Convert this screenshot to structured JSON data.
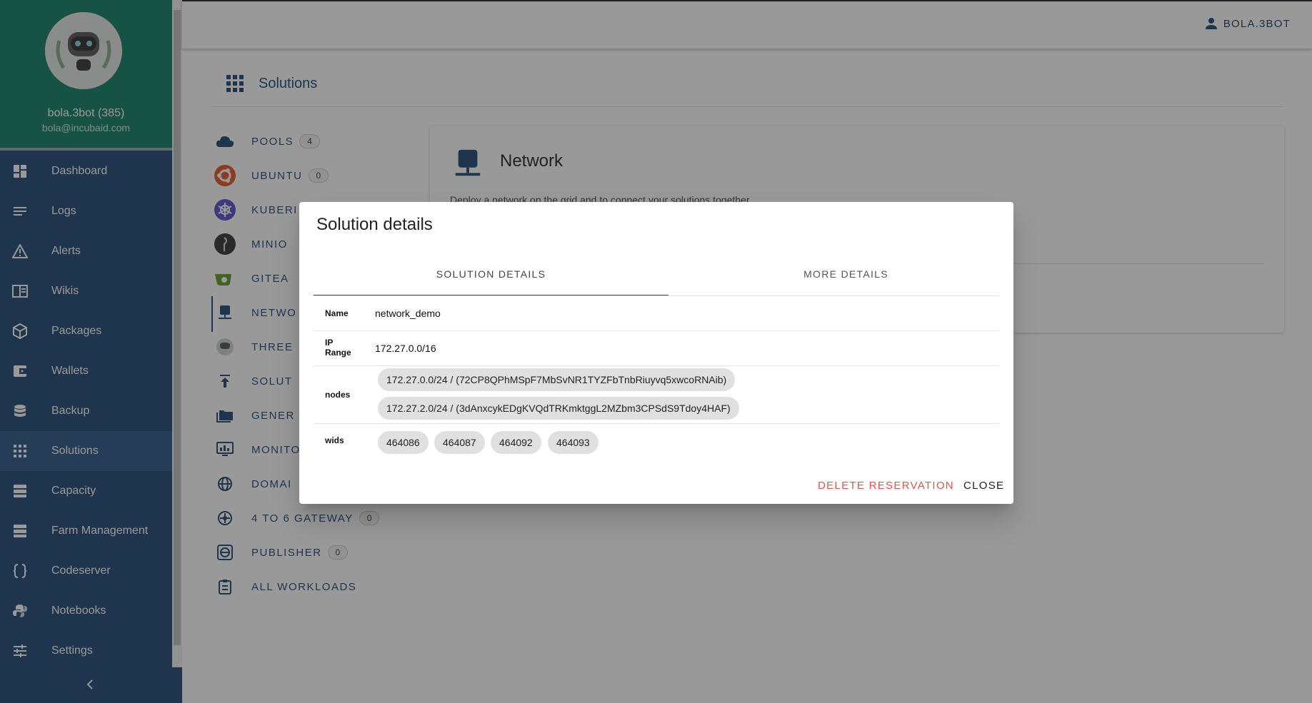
{
  "user": {
    "name": "bola.3bot (385)",
    "email": "bola@incubaid.com",
    "topbar_name": "BOLA.3BOT"
  },
  "sidebar": {
    "items": [
      {
        "label": "Dashboard",
        "icon": "dashboard-icon"
      },
      {
        "label": "Logs",
        "icon": "logs-icon"
      },
      {
        "label": "Alerts",
        "icon": "alert-icon"
      },
      {
        "label": "Wikis",
        "icon": "book-icon"
      },
      {
        "label": "Packages",
        "icon": "package-icon"
      },
      {
        "label": "Wallets",
        "icon": "wallet-icon"
      },
      {
        "label": "Backup",
        "icon": "database-icon"
      },
      {
        "label": "Solutions",
        "icon": "apps-icon",
        "active": true
      },
      {
        "label": "Capacity",
        "icon": "server-icon"
      },
      {
        "label": "Farm Management",
        "icon": "server-icon"
      },
      {
        "label": "Codeserver",
        "icon": "code-braces-icon"
      },
      {
        "label": "Notebooks",
        "icon": "python-icon"
      },
      {
        "label": "Settings",
        "icon": "tune-icon"
      }
    ]
  },
  "main": {
    "title": "Solutions",
    "solutions": [
      {
        "label": "POOLS",
        "badge": "4"
      },
      {
        "label": "UBUNTU",
        "badge": "0"
      },
      {
        "label": "KUBERI",
        "badge": ""
      },
      {
        "label": "MINIO",
        "badge": ""
      },
      {
        "label": "GITEA",
        "badge": ""
      },
      {
        "label": "NETWO",
        "badge": ""
      },
      {
        "label": "THREE",
        "badge": ""
      },
      {
        "label": "SOLUT",
        "badge": ""
      },
      {
        "label": "GENER",
        "badge": ""
      },
      {
        "label": "MONITO",
        "badge": ""
      },
      {
        "label": "DOMAI",
        "badge": ""
      },
      {
        "label": "4 TO 6 GATEWAY",
        "badge": "0"
      },
      {
        "label": "PUBLISHER",
        "badge": "0"
      },
      {
        "label": "ALL WORKLOADS",
        "badge": ""
      }
    ],
    "card": {
      "title": "Network",
      "description": "Deploy a network on the grid and to connect your solutions together"
    }
  },
  "dialog": {
    "title": "Solution details",
    "tabs": [
      "SOLUTION DETAILS",
      "MORE DETAILS"
    ],
    "rows": {
      "name_label": "Name",
      "name_value": "network_demo",
      "ip_label_1": "IP",
      "ip_label_2": "Range",
      "ip_value": "172.27.0.0/16",
      "nodes_label": "nodes",
      "nodes": [
        "172.27.0.0/24 / (72CP8QPhMSpF7MbSvNR1TYZFbTnbRiuyvq5xwcoRNAib)",
        "172.27.2.0/24 / (3dAnxcykEDgKVQdTRKmktggL2MZbm3CPSdS9Tdoy4HAF)"
      ],
      "wids_label": "wids",
      "wids": [
        "464086",
        "464087",
        "464092",
        "464093"
      ]
    },
    "actions": {
      "delete": "DELETE RESERVATION",
      "close": "CLOSE"
    }
  },
  "colors": {
    "sidebar": "#1e4673",
    "profile": "#107f63",
    "delete": "#e25450",
    "accent": "#1e4673"
  }
}
